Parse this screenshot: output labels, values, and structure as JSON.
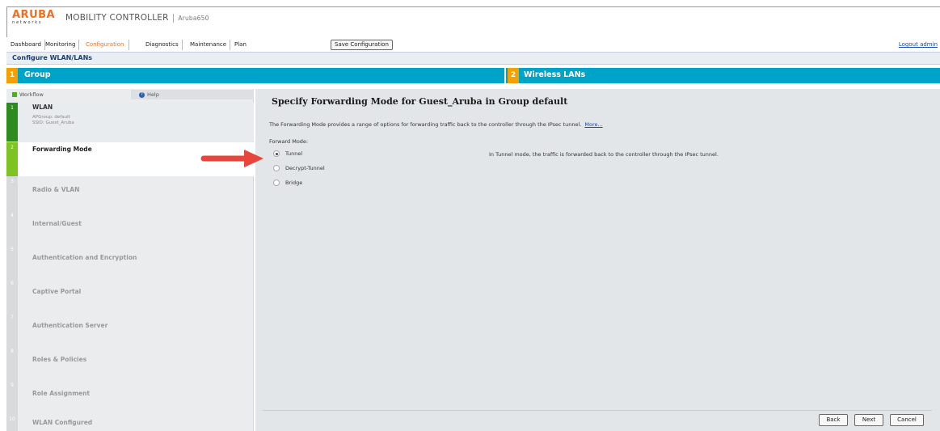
{
  "header": {
    "logo_brand": "ARUBA",
    "logo_sub": "networks",
    "product": "MOBILITY CONTROLLER",
    "separator": "|",
    "model": "Aruba650",
    "nav": [
      "Dashboard",
      "Monitoring",
      "Configuration",
      "Diagnostics",
      "Maintenance",
      "Plan"
    ],
    "active_tab": "Configuration",
    "save_label": "Save Configuration",
    "logout": "Logout admin",
    "brand_color": "#f26f21"
  },
  "breadcrumb": "Configure WLAN/LANs",
  "steps": [
    {
      "num": "1",
      "label": "Group"
    },
    {
      "num": "2",
      "label": "Wireless LANs"
    }
  ],
  "sidebar": {
    "workflow_tab": "Workflow",
    "help_tab": "Help",
    "items": [
      {
        "num": "1",
        "label": "WLAN",
        "sub1": "APGroup: default",
        "sub2": "SSID: Guest_Aruba"
      },
      {
        "num": "2",
        "label": "Forwarding Mode"
      },
      {
        "num": "3",
        "label": "Radio & VLAN"
      },
      {
        "num": "4",
        "label": "Internal/Guest"
      },
      {
        "num": "5",
        "label": "Authentication and Encryption"
      },
      {
        "num": "6",
        "label": "Captive Portal"
      },
      {
        "num": "7",
        "label": "Authentication Server"
      },
      {
        "num": "8",
        "label": "Roles & Policies"
      },
      {
        "num": "9",
        "label": "Role Assignment"
      },
      {
        "num": "10",
        "label": "WLAN Configured"
      }
    ]
  },
  "main": {
    "title": "Specify Forwarding Mode for Guest_Aruba in Group default",
    "description": "The Forwarding Mode provides a range of options for forwarding traffic back to the controller through the IPsec tunnel.",
    "more_link": "More...",
    "forward_mode_label": "Forward Mode:",
    "options": [
      {
        "label": "Tunnel",
        "checked": true
      },
      {
        "label": "Decrypt-Tunnel",
        "checked": false
      },
      {
        "label": "Bridge",
        "checked": false
      }
    ],
    "mode_description": "In Tunnel mode, the traffic is forwarded back to the controller through the IPsec tunnel.",
    "buttons": {
      "back": "Back",
      "next": "Next",
      "cancel": "Cancel"
    }
  },
  "annotation_arrow_color": "#e8453c"
}
